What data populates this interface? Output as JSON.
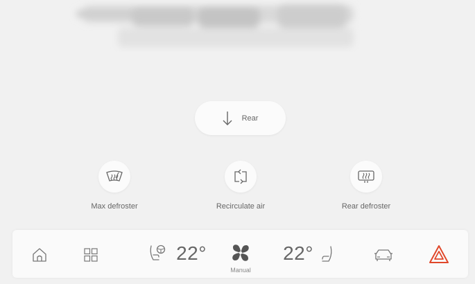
{
  "airflow": {
    "label": "Rear",
    "icon": "arrow-down-icon"
  },
  "functions": [
    {
      "label": "Max defroster",
      "icon": "max-defroster-icon"
    },
    {
      "label": "Recirculate air",
      "icon": "recirculate-icon"
    },
    {
      "label": "Rear defroster",
      "icon": "rear-defroster-icon"
    }
  ],
  "bottom_bar": {
    "home_icon": "home-icon",
    "apps_icon": "apps-grid-icon",
    "driver_temp": "22°",
    "passenger_temp": "22°",
    "fan_mode": "Manual",
    "car_icon": "car-icon",
    "hazard_icon": "hazard-icon",
    "hazard_color": "#e0472a"
  }
}
